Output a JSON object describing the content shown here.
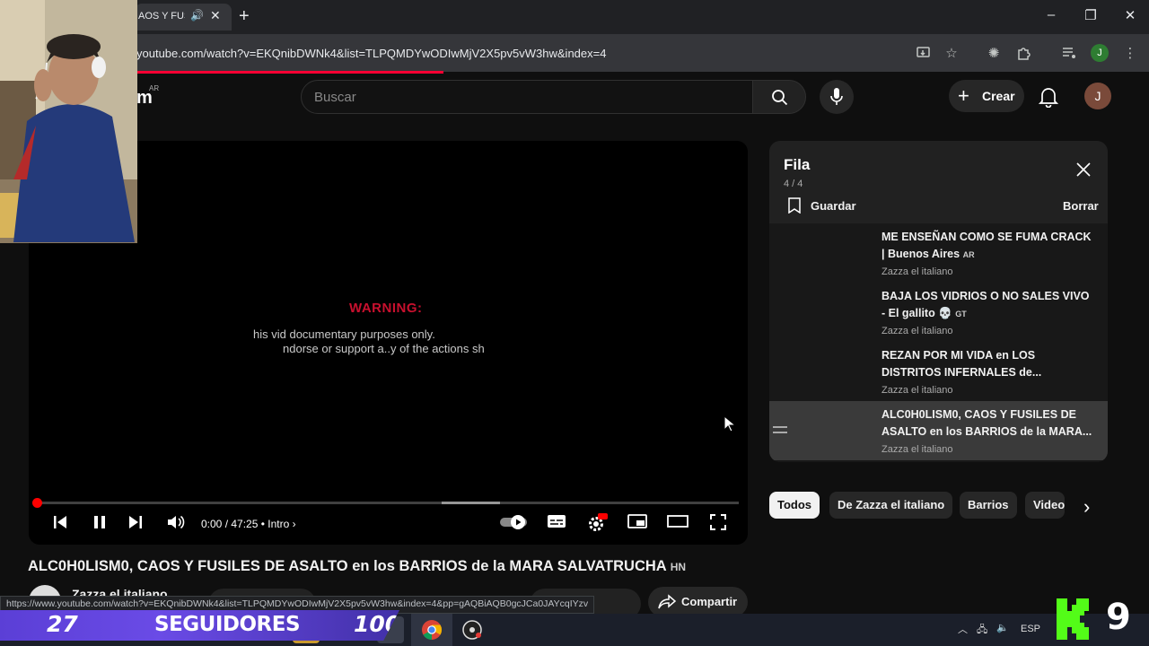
{
  "browser": {
    "tab": {
      "title": "AOS Y FUSI",
      "audio_icon": "speaker-icon",
      "close_symbol": "✕"
    },
    "new_tab_symbol": "+",
    "window_controls": {
      "minimize": "–",
      "maximize": "❐",
      "close": "✕"
    },
    "url": "youtube.com/watch?v=EKQnibDWNk4&list=TLPQMDYwODIwMjV2X5pv5vW3hw&index=4",
    "profile_initial": "J",
    "status_url": "https://www.youtube.com/watch?v=EKQnibDWNk4&list=TLPQMDYwODIwMjV2X5pv5vW3hw&index=4&pp=gAQBiAQB0gcJCa0JAYcqIYzv"
  },
  "youtube": {
    "logo_fragment": "m",
    "region": "AR",
    "search_placeholder": "Buscar",
    "create_label": "Crear",
    "avatar_initial": "J"
  },
  "player": {
    "overlay_warning": "WARNING:",
    "overlay_line1": "his vid         documentary purposes only.",
    "overlay_line2": "ndorse or support a..y of the actions sh",
    "time": "0:00 / 47:25",
    "chapter": "Intro",
    "progress_fraction": 0.0
  },
  "queue": {
    "title": "Fila",
    "count": "4 / 4",
    "save_label": "Guardar",
    "clear_label": "Borrar",
    "items": [
      {
        "title": "ME ENSEÑAN COMO SE FUMA CRACK | Buenos Aires",
        "tag": "AR",
        "channel": "Zazza el italiano"
      },
      {
        "title": "BAJA LOS VIDRIOS O NO SALES VIVO - El gallito 💀",
        "tag": "GT",
        "channel": "Zazza el italiano"
      },
      {
        "title": "REZAN POR MI VIDA en LOS DISTRITOS INFERNALES de...",
        "tag": "",
        "channel": "Zazza el italiano"
      },
      {
        "title": "ALC0H0LISM0, CAOS Y FUSILES DE ASALTO en los BARRIOS de la MARA...",
        "tag": "",
        "channel": "Zazza el italiano"
      }
    ]
  },
  "chips": [
    "Todos",
    "De Zazza el italiano",
    "Barrios",
    "Video"
  ],
  "video": {
    "title": "ALC0H0LISM0, CAOS Y FUSILES DE ASALTO en los BARRIOS de la MARA SALVATRUCHA",
    "title_tag": "HN",
    "channel": "Zazza el italiano",
    "share_label": "Compartir"
  },
  "taskbar": {
    "language": "ESP"
  },
  "stream_overlay": {
    "followers_count": "27",
    "followers_label": "SEGUIDORES",
    "followers_goal": "100",
    "kick_number": "9"
  },
  "colors": {
    "youtube_red": "#ff0033",
    "follower_bar": "#6a4be6",
    "kick_green": "#53fc18"
  }
}
